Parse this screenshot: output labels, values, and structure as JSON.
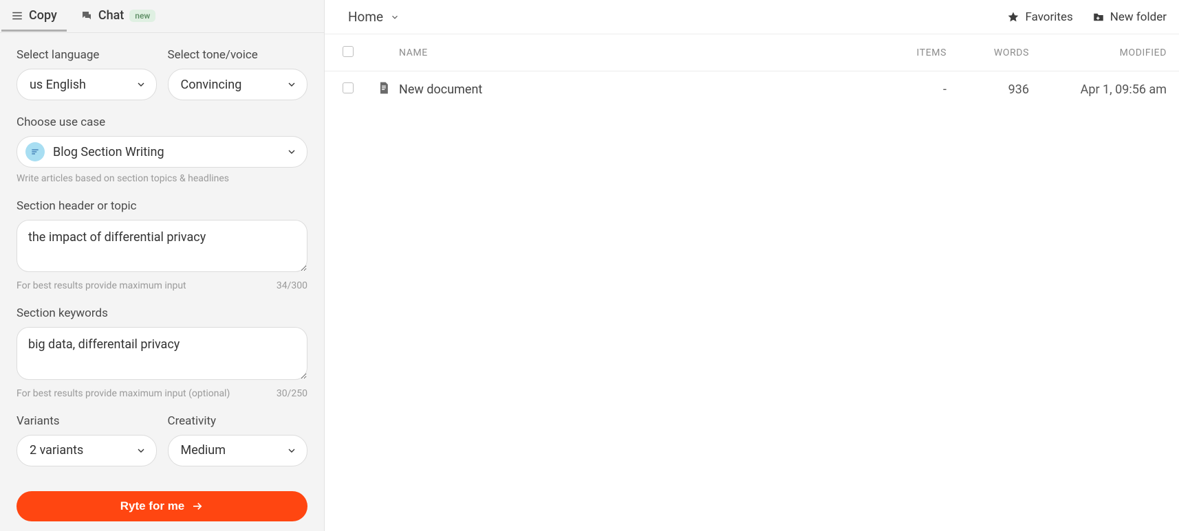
{
  "sidebar": {
    "tabs": {
      "copy": "Copy",
      "chat": "Chat",
      "chat_badge": "new"
    },
    "language": {
      "label": "Select language",
      "value": "us English"
    },
    "tone": {
      "label": "Select tone/voice",
      "value": "Convincing"
    },
    "usecase": {
      "label": "Choose use case",
      "value": "Blog Section Writing",
      "hint": "Write articles based on section topics & headlines"
    },
    "section_header": {
      "label": "Section header or topic",
      "value": "the impact of differential privacy",
      "hint": "For best results provide maximum input",
      "counter": "34/300"
    },
    "section_keywords": {
      "label": "Section keywords",
      "value": "big data, differentail privacy",
      "hint": "For best results provide maximum input (optional)",
      "counter": "30/250"
    },
    "variants": {
      "label": "Variants",
      "value": "2 variants"
    },
    "creativity": {
      "label": "Creativity",
      "value": "Medium"
    },
    "cta": "Ryte for me"
  },
  "main": {
    "breadcrumb": "Home",
    "actions": {
      "favorites": "Favorites",
      "new_folder": "New folder"
    },
    "columns": {
      "name": "NAME",
      "items": "ITEMS",
      "words": "WORDS",
      "modified": "MODIFIED"
    },
    "rows": [
      {
        "name": "New document",
        "items": "-",
        "words": "936",
        "modified": "Apr 1, 09:56 am"
      }
    ]
  }
}
